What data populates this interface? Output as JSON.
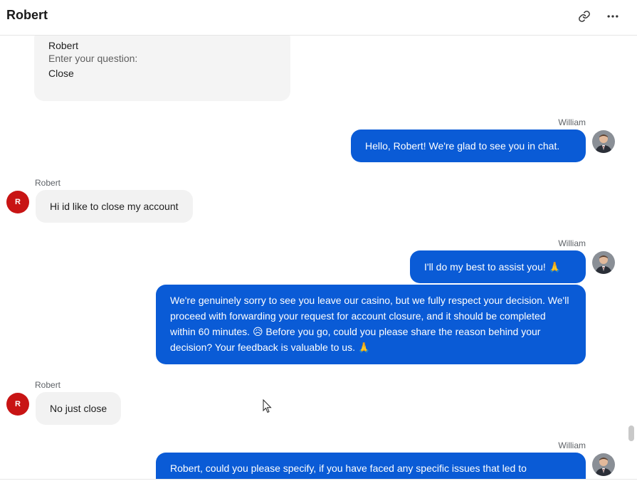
{
  "header": {
    "title": "Robert"
  },
  "form_card": {
    "name_value": "Robert",
    "question_label": "Enter your question:",
    "question_value": "Close"
  },
  "messages": [
    {
      "sender": "William",
      "text": "Hello, Robert! We're glad to see you in chat."
    },
    {
      "sender": "Robert",
      "avatar_letter": "R",
      "text": "Hi id like to close my account"
    },
    {
      "sender": "William",
      "text": "I'll do my best to assist you! 🙏"
    },
    {
      "text": "We're genuinely sorry to see you leave our casino, but we fully respect your decision. We'll proceed with forwarding your request for account closure, and it should be completed within 60 minutes. 😥 Before you go, could you please share the reason behind your decision? Your feedback is valuable to us. 🙏"
    },
    {
      "sender": "Robert",
      "avatar_letter": "R",
      "text": "No just close"
    },
    {
      "sender": "William",
      "text": "Robert, could you please specify, if you have faced any specific issues that led to"
    }
  ],
  "colors": {
    "agent_bubble": "#0a5bd6",
    "user_bubble": "#f2f2f2",
    "user_avatar": "#c81414"
  }
}
